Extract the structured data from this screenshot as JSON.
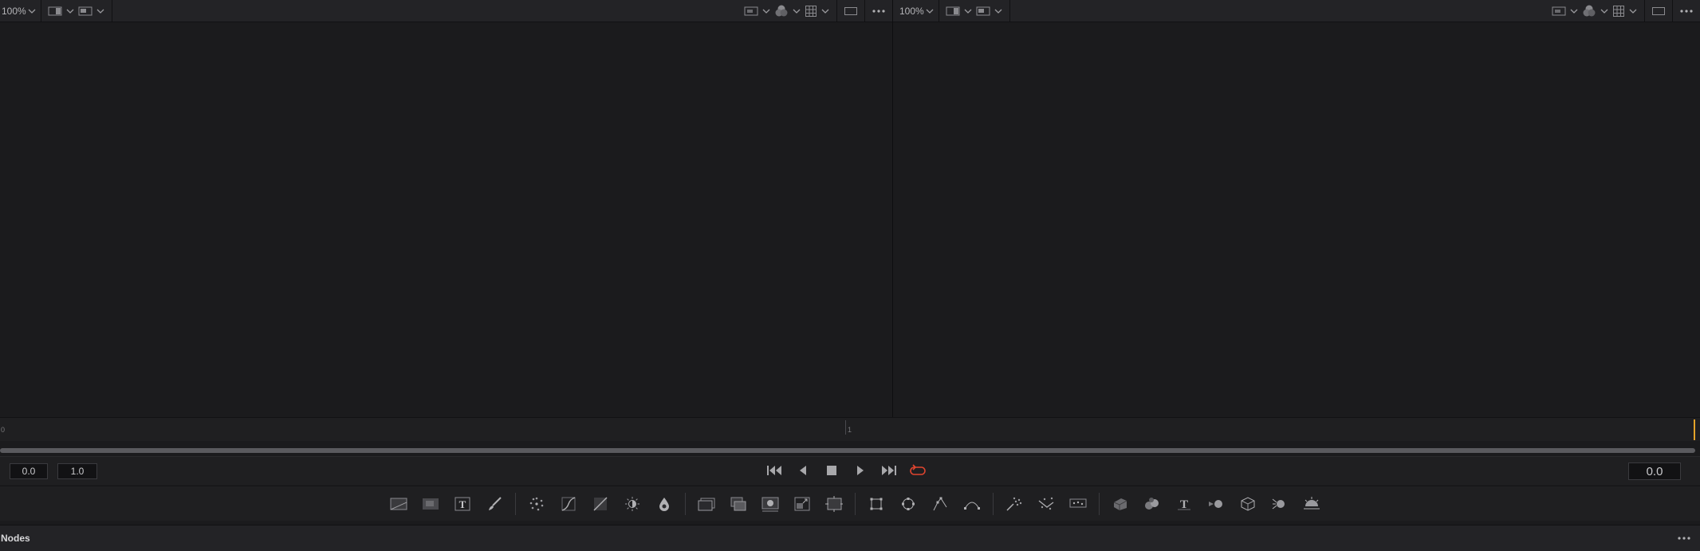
{
  "viewers": {
    "left": {
      "zoom": "100%"
    },
    "right": {
      "zoom": "100%"
    }
  },
  "ruler": {
    "start_label": "0",
    "mid_label": "1"
  },
  "transport": {
    "start_time": "0.0",
    "end_time": "1.0",
    "current_time": "0.0",
    "loop_color": "#e0452f"
  },
  "nodes_panel": {
    "title": "Nodes"
  },
  "colors": {
    "playhead": "#e3a32a",
    "accent": "#e0452f"
  },
  "toolbar": {
    "groups": [
      [
        "background-icon",
        "image-plane-icon",
        "text-icon",
        "paint-icon"
      ],
      [
        "particles-icon",
        "color-curves-icon",
        "color-corrector-icon",
        "brightness-contrast-icon",
        "blur-icon"
      ],
      [
        "loader-icon",
        "merge-icon",
        "mask-icon",
        "resize-icon",
        "transform-icon"
      ],
      [
        "rectangle-mask-icon",
        "ellipse-mask-icon",
        "polygon-mask-icon",
        "bspline-mask-icon"
      ],
      [
        "particle-emitter-icon",
        "particle-render-icon",
        "particle-kill-icon"
      ],
      [
        "shape3d-icon",
        "merge3d-icon",
        "text3d-icon",
        "camera3d-icon",
        "renderer3d-icon",
        "light3d-icon",
        "ambient-light-icon"
      ]
    ]
  }
}
